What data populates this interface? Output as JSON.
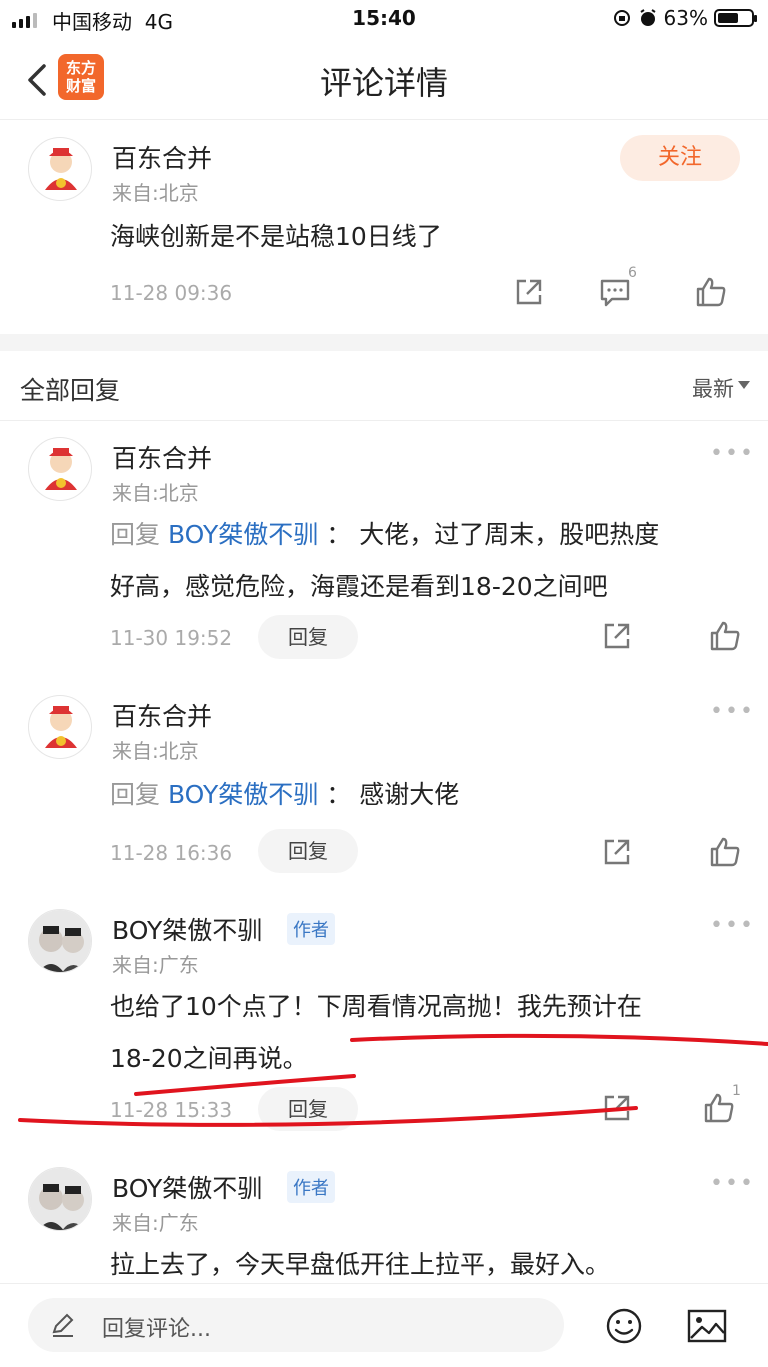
{
  "status_bar": {
    "carrier": "中国移动",
    "network": "4G",
    "time": "15:40",
    "battery": "63%",
    "battery_level": 0.63
  },
  "nav": {
    "title": "评论详情",
    "logo_line1": "东方",
    "logo_line2": "财富"
  },
  "post": {
    "user": "百东合并",
    "from": "来自:北京",
    "follow": "关注",
    "text": "海峡创新是不是站稳10日线了",
    "time": "11-28 09:36",
    "comment_count": "6"
  },
  "section": {
    "label": "全部回复",
    "sort": "最新"
  },
  "replies": [
    {
      "user": "百东合并",
      "from": "来自:北京",
      "reply_prefix": "回复",
      "target": "BOY桀傲不驯",
      "sep": "：",
      "text_line1": "大佬，过了周末，股吧热度",
      "text_line2": "好高，感觉危险，海霞还是看到18-20之间吧",
      "time": "11-30 19:52",
      "reply_btn": "回复"
    },
    {
      "user": "百东合并",
      "from": "来自:北京",
      "reply_prefix": "回复",
      "target": "BOY桀傲不驯",
      "sep": "：",
      "text_line1": "感谢大佬",
      "time": "11-28 16:36",
      "reply_btn": "回复"
    },
    {
      "user": "BOY桀傲不驯",
      "tag": "作者",
      "from": "来自:广东",
      "text_line1": "也给了10个点了！下周看情况高抛！我先预计在",
      "text_line2": "18-20之间再说。",
      "time": "11-28 15:33",
      "reply_btn": "回复",
      "like_count": "1"
    },
    {
      "user": "BOY桀傲不驯",
      "tag": "作者",
      "from": "来自:广东",
      "text_line1": "拉上去了，今天早盘低开往上拉平，最好入。"
    }
  ],
  "bottom": {
    "placeholder": "回复评论..."
  },
  "colors": {
    "accent": "#f2672b",
    "link": "#2b6fc2",
    "annotation": "#e0141e"
  },
  "icons": [
    "back-arrow-icon",
    "share-icon",
    "comment-icon",
    "thumbs-up-icon",
    "more-dots-icon",
    "pen-icon",
    "emoji-icon",
    "image-icon"
  ]
}
